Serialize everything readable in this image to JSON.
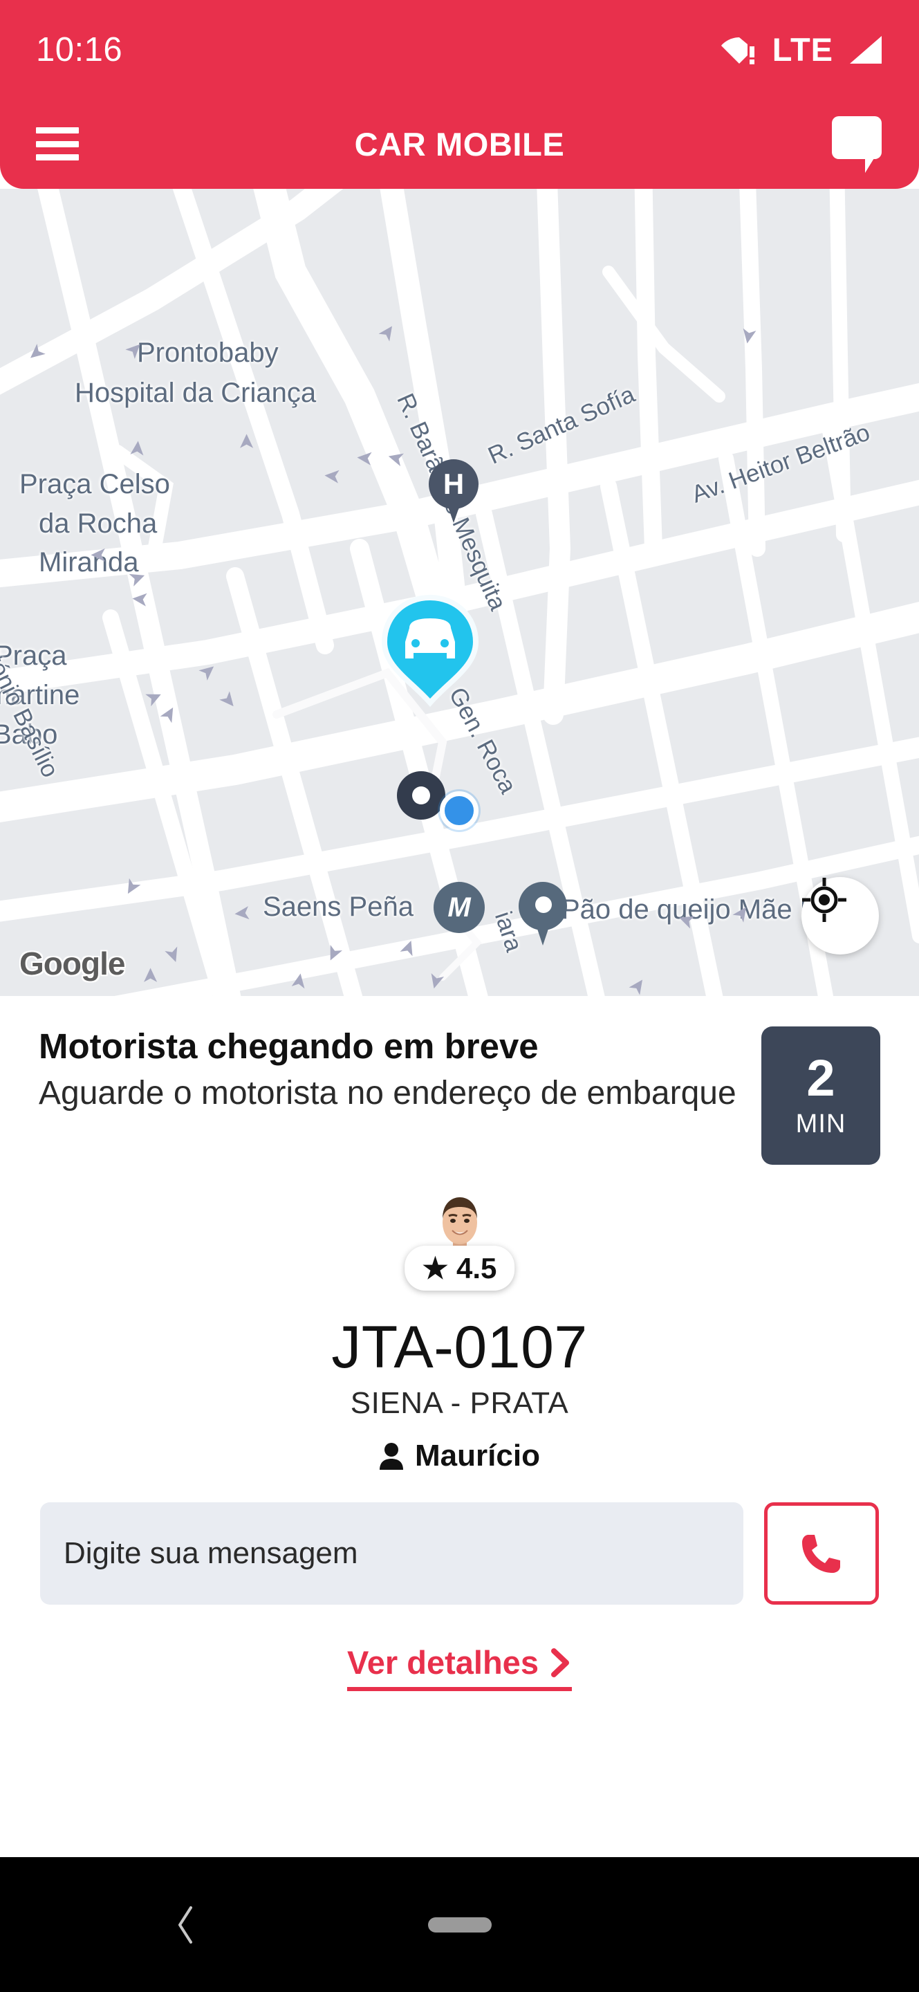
{
  "statusbar": {
    "time": "10:16",
    "network_label": "LTE",
    "wifi_icon": "wifi-warning-icon",
    "signal_icon": "signal-triangle-icon"
  },
  "appbar": {
    "title": "CAR MOBILE",
    "menu_icon": "hamburger-menu-icon",
    "chat_icon": "chat-bubble-icon"
  },
  "map": {
    "provider_logo": "Google",
    "locate_icon": "my-location-icon",
    "places": [
      {
        "name": "Prontobaby",
        "type": "hospital"
      },
      {
        "name": "Hospital da Criança",
        "type": "hospital"
      },
      {
        "name": "Praça Celso",
        "type": "square"
      },
      {
        "name": "da Rocha",
        "type": "square"
      },
      {
        "name": "Miranda",
        "type": "square"
      },
      {
        "name": "Praça",
        "type": "square"
      },
      {
        "name": "martine",
        "type": "square"
      },
      {
        "name": "Babo",
        "type": "square"
      },
      {
        "name": "Saens Peña",
        "type": "metro-station"
      },
      {
        "name": "Pão de queijo Mãe Maria",
        "type": "poi"
      }
    ],
    "streets": [
      "R. Barão de Mesquita",
      "R. Santa Sofía",
      "Av. Heitor Beltrão",
      "António Basílio",
      "R. Gen. Roca",
      "iara"
    ],
    "markers": {
      "hospital_letter": "H",
      "metro_letter": "M",
      "car_marker": "car-pin-icon",
      "pickup_marker": "pickup-dot-icon",
      "user_location": "user-location-dot"
    },
    "colors": {
      "background": "#E8EAED",
      "road": "#FFFFFF",
      "car_pin": "#22C4ED",
      "label": "#5C6B7F"
    }
  },
  "ride": {
    "status_title": "Motorista chegando em breve",
    "status_subtitle": "Aguarde o motorista no endereço de embarque",
    "eta_value": "2",
    "eta_unit": "MIN"
  },
  "driver": {
    "avatar_alt": "driver-photo",
    "rating": "★ 4.5",
    "plate": "JTA-0107",
    "vehicle": "SIENA - PRATA",
    "name": "Maurício",
    "person_icon": "person-icon"
  },
  "actions": {
    "message_placeholder": "Digite sua mensagem",
    "message_value": "",
    "call_icon": "phone-icon",
    "details_label": "Ver detalhes",
    "details_chevron": "›"
  },
  "navbar": {
    "back_icon": "back-chevron-icon",
    "home_icon": "home-pill-icon"
  },
  "theme": {
    "brand_red": "#E8304C",
    "eta_badge": "#3D4759",
    "input_bg": "#E9ECF2"
  }
}
